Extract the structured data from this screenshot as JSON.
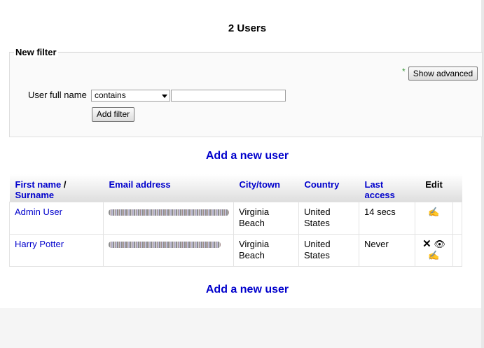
{
  "page": {
    "title": "2 Users"
  },
  "filter": {
    "legend": "New filter",
    "required_mark": "*",
    "show_advanced_label": "Show advanced",
    "field_label": "User full name",
    "operator_selected": "contains",
    "value": "",
    "add_filter_label": "Add filter"
  },
  "actions": {
    "add_user_label": "Add a new user"
  },
  "table": {
    "headers": {
      "name_first": "First name",
      "name_sep": " / ",
      "name_last": "Surname",
      "email": "Email address",
      "city": "City/town",
      "country": "Country",
      "last_access": "Last access",
      "edit": "Edit"
    },
    "rows": [
      {
        "name": "Admin User",
        "email_obscured": true,
        "city": "Virginia Beach",
        "country": "United States",
        "last_access": "14 secs"
      },
      {
        "name": "Harry Potter",
        "email_obscured": true,
        "city": "Virginia Beach",
        "country": "United States",
        "last_access": "Never"
      }
    ]
  },
  "icons": {
    "edit": "edit-icon",
    "delete": "delete-icon",
    "hide": "eye-icon"
  }
}
